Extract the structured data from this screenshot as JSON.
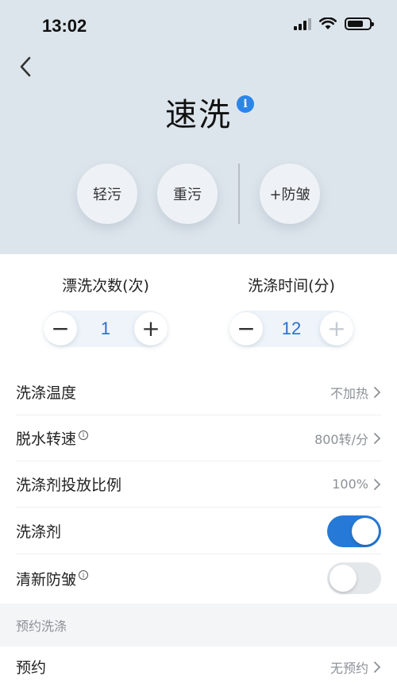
{
  "status_bar": {
    "time": "13:02"
  },
  "header": {
    "title": "速洗",
    "info_icon": "i"
  },
  "modes": [
    {
      "label": "轻污"
    },
    {
      "label": "重污"
    },
    {
      "label": "+防皱"
    }
  ],
  "counters": {
    "rinse": {
      "label": "漂洗次数(次)",
      "value": "1",
      "minus": "−",
      "plus": "+"
    },
    "wash_time": {
      "label": "洗涤时间(分)",
      "value": "12",
      "minus": "−",
      "plus": "+"
    }
  },
  "settings": [
    {
      "label": "洗涤温度",
      "value": "不加热"
    },
    {
      "label": "脱水转速",
      "tip": "i",
      "value": "800转/分"
    },
    {
      "label": "洗涤剂投放比例",
      "value": "100%"
    },
    {
      "label": "洗涤剂",
      "toggle": true
    },
    {
      "label": "清新防皱",
      "tip": "i",
      "toggle": false
    }
  ],
  "schedule_section": {
    "header": "预约洗涤"
  },
  "schedule": {
    "label": "预约",
    "value": "无预约"
  },
  "colors": {
    "accent": "#2679d6",
    "hero_bg": "#dde5ec",
    "value_blue": "#2b6fce"
  }
}
